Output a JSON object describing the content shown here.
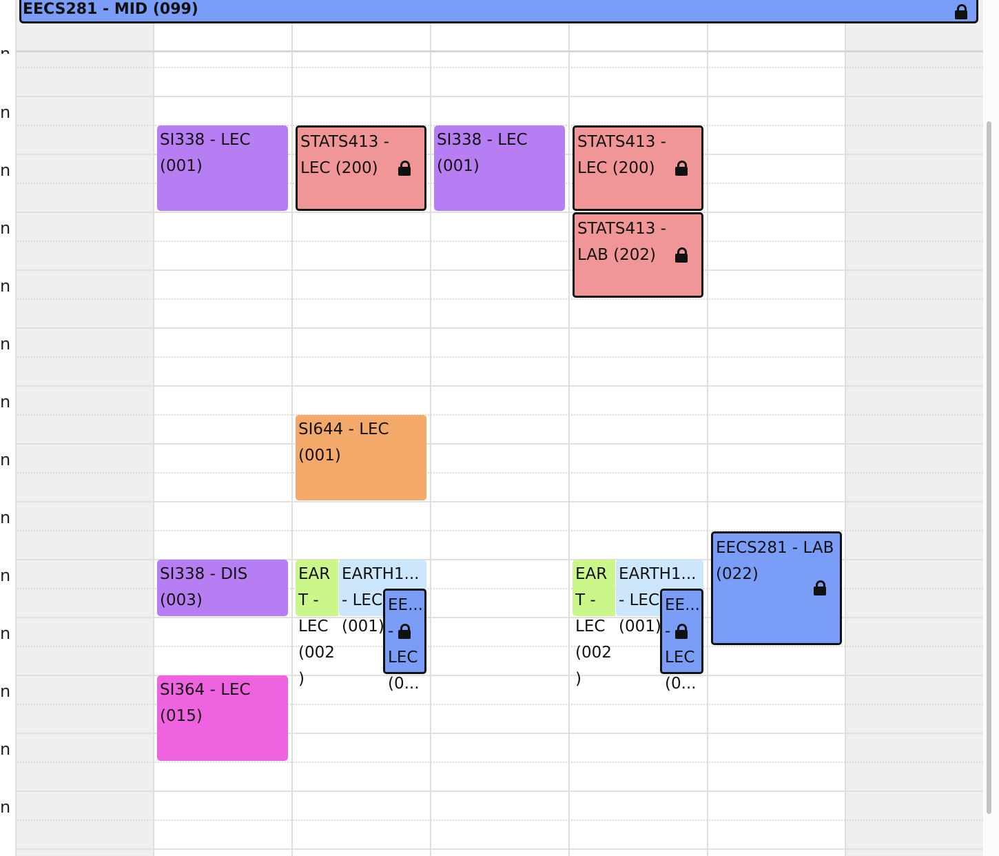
{
  "allday_event": {
    "label": "EECS281 - MID (099)",
    "locked": true,
    "color": "#7a9df8"
  },
  "time_labels": [
    "n",
    "n",
    "n",
    "n",
    "n",
    "n",
    "n",
    "n",
    "n",
    "n",
    "n",
    "n",
    "n"
  ],
  "truncated_top_label": "n",
  "events": [
    {
      "id": "si338-lec-mon",
      "label": "SI338 - LEC (001)",
      "color": "#b77ef3",
      "locked": false
    },
    {
      "id": "stats413-lec-tue",
      "label": "STATS413 - LEC (200)",
      "color": "#f09696",
      "locked": true
    },
    {
      "id": "si338-lec-wed",
      "label": "SI338 - LEC (001)",
      "color": "#b77ef3",
      "locked": false
    },
    {
      "id": "stats413-lec-thu",
      "label": "STATS413 - LEC (200)",
      "color": "#f09696",
      "locked": true
    },
    {
      "id": "stats413-lab-thu",
      "label": "STATS413 - LAB (202)",
      "color": "#f09696",
      "locked": true
    },
    {
      "id": "si644-lec-tue",
      "label": "SI644 - LEC (001)",
      "color": "#f2a96a",
      "locked": false
    },
    {
      "id": "eecs281-lab-fri",
      "label": "EECS281 - LAB (022)",
      "color": "#7a9df8",
      "locked": true
    },
    {
      "id": "si338-dis-mon",
      "label": "SI338 - DIS (003)",
      "color": "#b77ef3",
      "locked": false
    },
    {
      "id": "earth-a-tue",
      "label": "EART - LEC (002)",
      "color": "#cbf78a",
      "locked": false
    },
    {
      "id": "earth-b-tue",
      "label": "EARTH1... - LEC (001)",
      "color": "#cce6fb",
      "locked": false
    },
    {
      "id": "ee-tue",
      "label": "EE... - LEC (0...",
      "color": "#7a9df8",
      "locked": true
    },
    {
      "id": "earth-a-thu",
      "label": "EART - LEC (002)",
      "color": "#cbf78a",
      "locked": false
    },
    {
      "id": "earth-b-thu",
      "label": "EARTH1... - LEC (001)",
      "color": "#cce6fb",
      "locked": false
    },
    {
      "id": "ee-thu",
      "label": "EE... - LEC (0...",
      "color": "#7a9df8",
      "locked": true
    },
    {
      "id": "si364-lec-mon",
      "label": "SI364 - LEC (015)",
      "color": "#ef63e0",
      "locked": false
    }
  ]
}
